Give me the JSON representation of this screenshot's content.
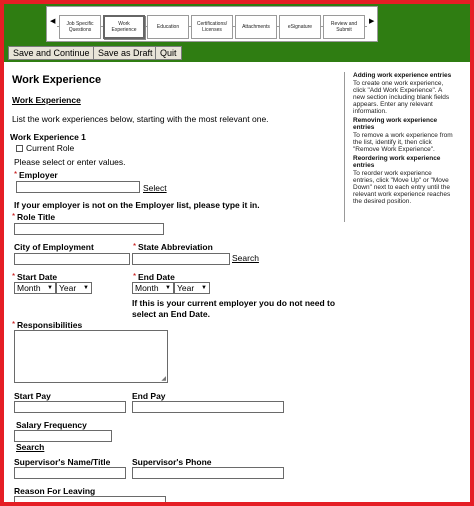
{
  "nav": {
    "prev_arrow": "◀",
    "next_arrow": "▶",
    "steps": [
      {
        "label": "Job Specific Questions"
      },
      {
        "label": "Work Experience"
      },
      {
        "label": "Education"
      },
      {
        "label": "Certifications/ Licenses"
      },
      {
        "label": "Attachments"
      },
      {
        "label": "eSignature"
      },
      {
        "label": "Review and Submit"
      }
    ]
  },
  "toolbar": {
    "save_continue": "Save and Continue",
    "save_draft": "Save as Draft",
    "quit": "Quit"
  },
  "page": {
    "title": "Work Experience",
    "section_link": "Work Experience",
    "instructions": "List the work experiences below, starting with the most relevant one.",
    "entry_title": "Work Experience 1",
    "current_role_label": "Current Role",
    "select_prompt": "Please select or enter values.",
    "required_marker": "*",
    "employer_label": "Employer",
    "employer_value": "",
    "select_link": "Select",
    "employer_hint": "If your employer is not on the Employer list, please type it in.",
    "role_title_label": "Role Title",
    "role_title_value": "",
    "city_label": "City of Employment",
    "city_value": "",
    "state_label": "State Abbreviation",
    "state_value": "",
    "search_link": "Search",
    "start_date_label": "Start Date",
    "end_date_label": "End Date",
    "month_option": "Month",
    "year_option": "Year",
    "current_employer_hint_1": "If this is your current employer you do not need to",
    "current_employer_hint_2": "select an End Date.",
    "responsibilities_label": "Responsibilities",
    "start_pay_label": "Start Pay",
    "end_pay_label": "End Pay",
    "salary_freq_label": "Salary Frequency",
    "salary_search_link": "Search",
    "supervisor_name_label": "Supervisor's Name/Title",
    "supervisor_phone_label": "Supervisor's Phone",
    "reason_label": "Reason For Leaving"
  },
  "sidebar": {
    "adding_title": "Adding work experience entries",
    "adding_lines": [
      "To create one work experience,",
      "click \"Add Work Experience\". A",
      "new section including blank fields",
      "appears. Enter any relevant",
      "information."
    ],
    "removing_title_1": "Removing work experience",
    "removing_title_2": "entries",
    "removing_lines": [
      "To remove a work experience from",
      "the list, identify it, then click",
      "\"Remove Work Experience\"."
    ],
    "reordering_title_1": "Reordering work experience",
    "reordering_title_2": "entries",
    "reordering_lines": [
      "To reorder work experience",
      "entries, click \"Move Up\" or \"Move",
      "Down\" next to each entry until the",
      "relevant work experience reaches",
      "the desired position."
    ]
  },
  "colors": {
    "accent_green": "#2f7d12",
    "frame_red": "#e51e25",
    "required_red": "#c00000"
  }
}
